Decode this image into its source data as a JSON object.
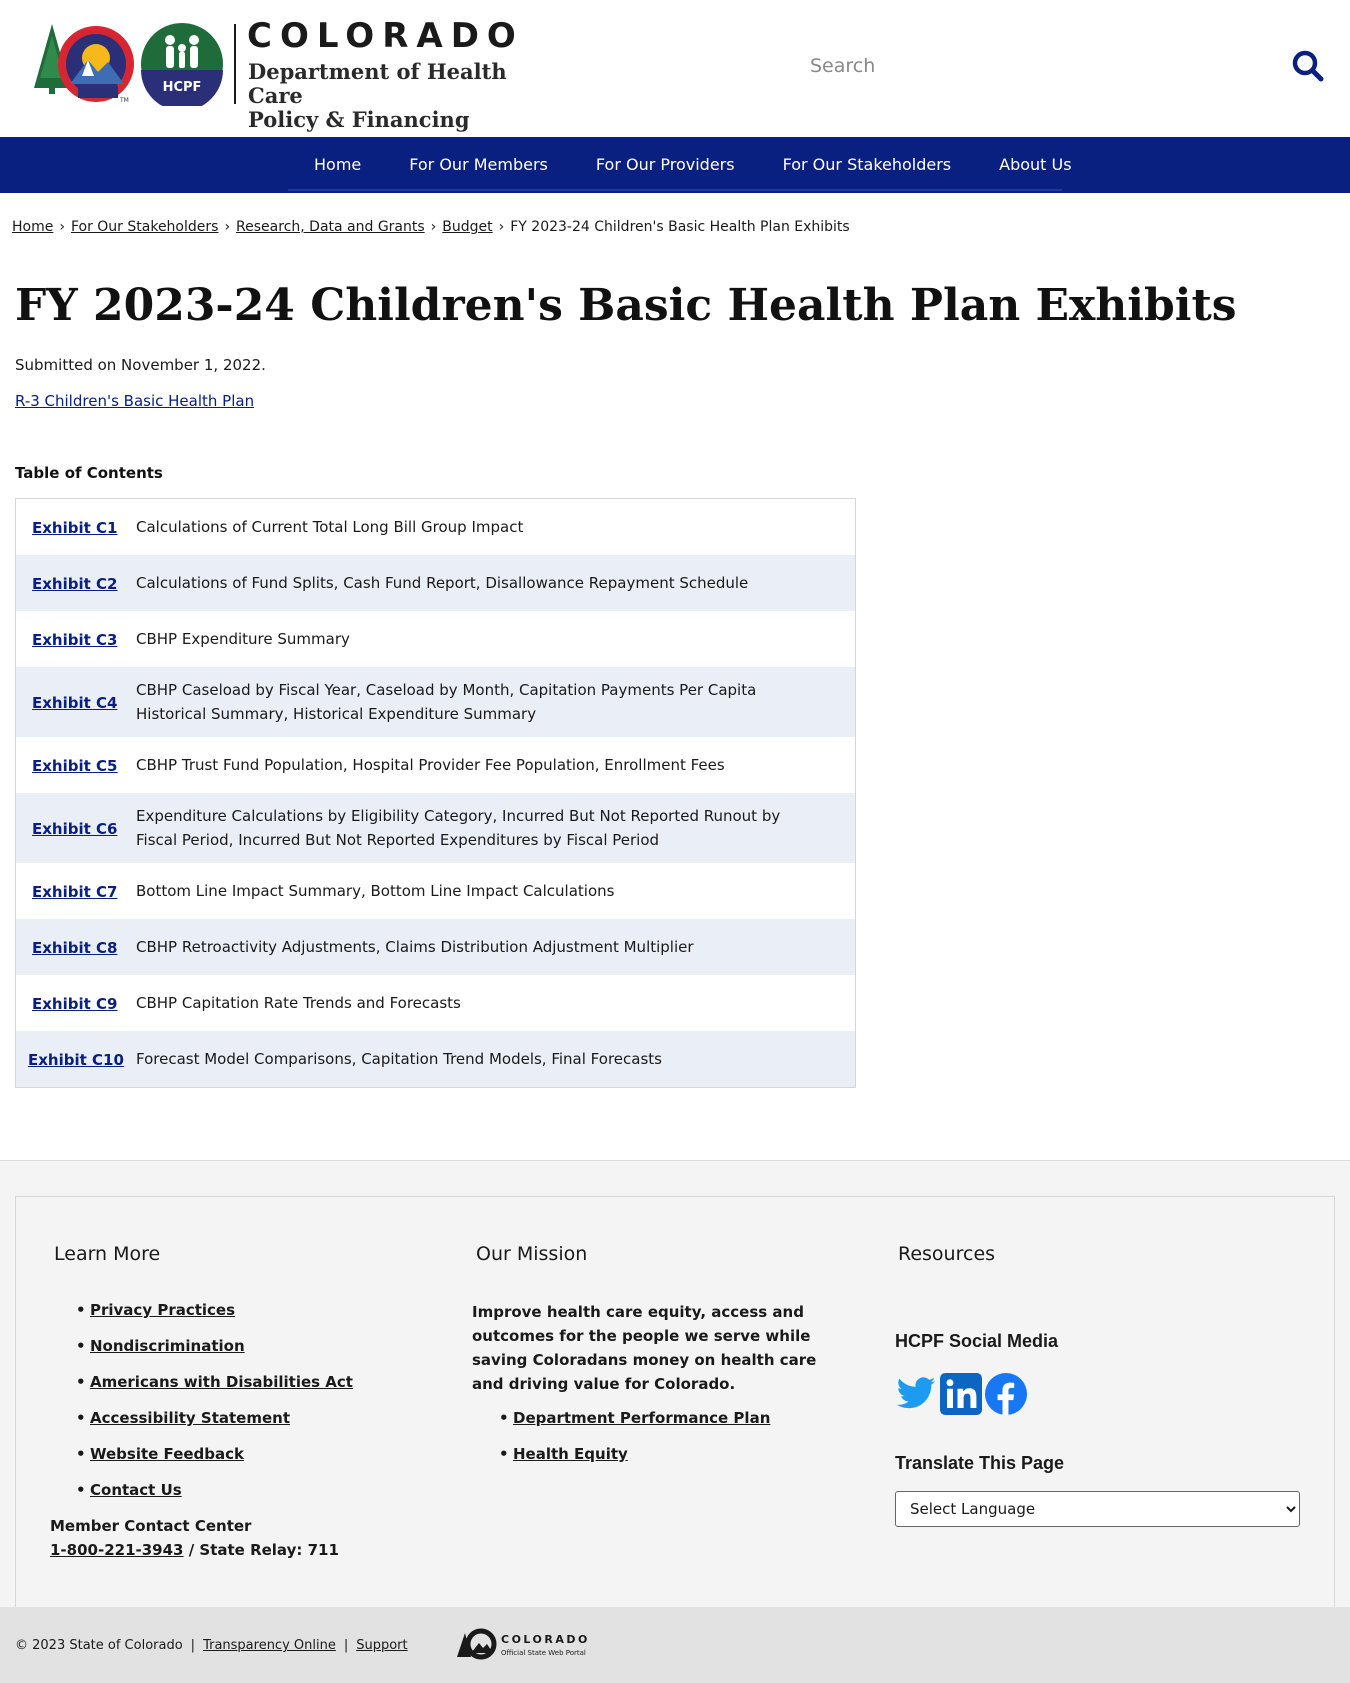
{
  "header": {
    "state_name": "COLORADO",
    "department_line1": "Department of Health Care",
    "department_line2": "Policy & Financing",
    "hcpf_badge": "HCPF",
    "search_placeholder": "Search"
  },
  "nav": {
    "items": [
      "Home",
      "For Our Members",
      "For Our Providers",
      "For Our Stakeholders",
      "About Us"
    ]
  },
  "breadcrumb": {
    "items": [
      "Home",
      "For Our Stakeholders",
      "Research, Data and Grants",
      "Budget"
    ],
    "separator": "›",
    "current": "FY 2023-24 Children's Basic Health Plan Exhibits"
  },
  "page": {
    "title": "FY 2023-24 Children's Basic Health Plan Exhibits",
    "submitted": "Submitted on November 1, 2022.",
    "r3_link": "R-3 Children's Basic Health Plan",
    "toc_heading": "Table of Contents"
  },
  "toc": [
    {
      "link": "Exhibit C1",
      "desc": "Calculations of Current Total Long Bill Group Impact"
    },
    {
      "link": "Exhibit C2",
      "desc": "Calculations of Fund Splits, Cash Fund Report, Disallowance Repayment Schedule"
    },
    {
      "link": "Exhibit C3",
      "desc": "CBHP Expenditure Summary"
    },
    {
      "link": "Exhibit C4",
      "desc": "CBHP Caseload by Fiscal Year, Caseload by Month, Capitation Payments Per Capita Historical Summary, Historical Expenditure Summary"
    },
    {
      "link": "Exhibit C5",
      "desc": "CBHP Trust Fund Population, Hospital Provider Fee Population, Enrollment Fees"
    },
    {
      "link": "Exhibit C6",
      "desc": "Expenditure Calculations by Eligibility Category, Incurred But Not Reported Runout by Fiscal Period, Incurred But Not Reported Expenditures by Fiscal Period"
    },
    {
      "link": "Exhibit C7",
      "desc": "Bottom Line Impact Summary, Bottom Line Impact Calculations"
    },
    {
      "link": "Exhibit C8",
      "desc": "CBHP Retroactivity Adjustments, Claims Distribution Adjustment Multiplier"
    },
    {
      "link": "Exhibit C9",
      "desc": "CBHP Capitation Rate Trends and Forecasts"
    },
    {
      "link": "Exhibit C10",
      "desc": "Forecast Model Comparisons, Capitation Trend Models, Final Forecasts"
    }
  ],
  "footer": {
    "learn_more": {
      "title": "Learn More",
      "links": [
        "Privacy Practices",
        "Nondiscrimination",
        "Americans with Disabilities Act",
        "Accessibility Statement",
        "Website Feedback",
        "Contact Us"
      ],
      "contact_label": "Member Contact Center",
      "contact_phone": "1-800-221-3943",
      "contact_relay": " / State Relay: 711"
    },
    "mission": {
      "title": "Our Mission",
      "text": "Improve health care equity, access and outcomes for the people we serve while saving Coloradans money on health care and driving value for Colorado.",
      "links": [
        "Department Performance Plan",
        "Health Equity"
      ]
    },
    "resources": {
      "title": "Resources",
      "social_heading": "HCPF Social Media",
      "social_icons": [
        "twitter-icon",
        "linkedin-icon",
        "facebook-icon"
      ],
      "translate_heading": "Translate This Page",
      "language_select": "Select Language"
    },
    "bottom": {
      "copyright": "© 2023 State of Colorado",
      "links": [
        "Transparency Online",
        "Support"
      ],
      "portal_name": "COLORADO",
      "portal_tagline": "Official State Web Portal"
    }
  },
  "colors": {
    "nav_bg": "#0a2081",
    "link": "#0a2081",
    "row_alt": "#eaeef6",
    "footer_bg": "#f4f4f4",
    "bottom_bar": "#e2e2e2",
    "twitter": "#1d9bf0",
    "linkedin": "#0a66c2",
    "facebook": "#1877f2"
  }
}
